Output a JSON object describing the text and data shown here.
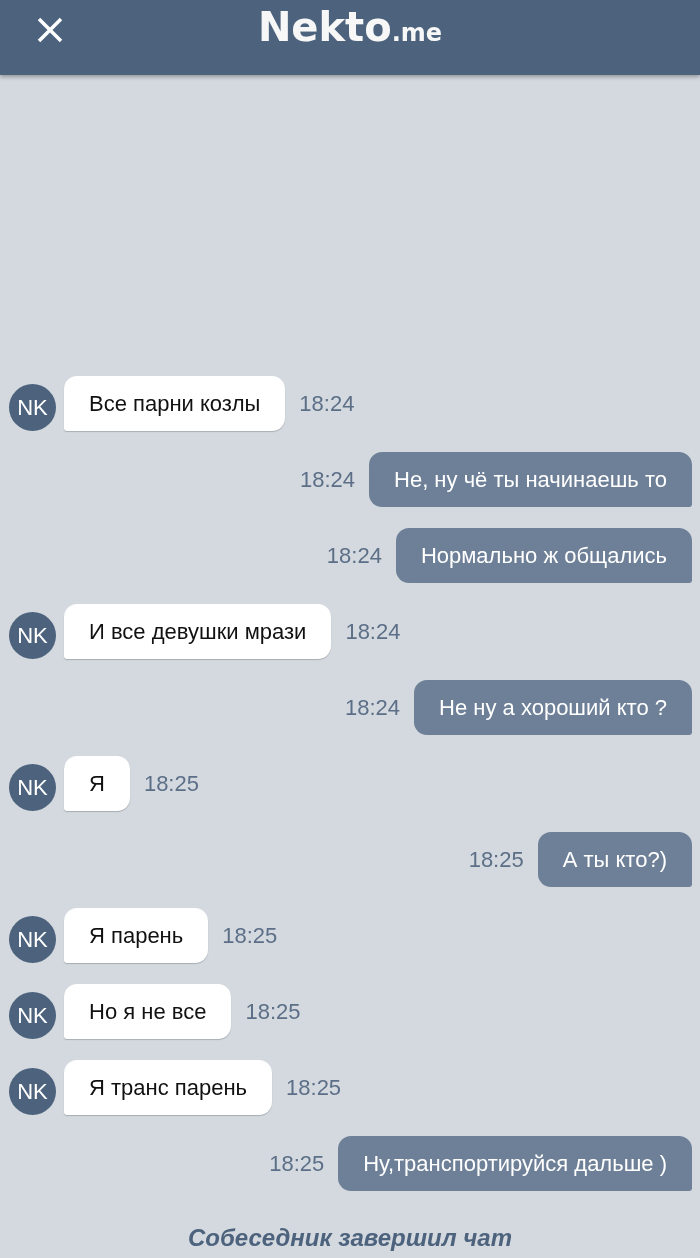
{
  "header": {
    "logo": "Nekto",
    "logo_suffix": ".me"
  },
  "messages": [
    {
      "kind": "incoming",
      "avatar": "NK",
      "text": "Все парни козлы",
      "time": "18:24"
    },
    {
      "kind": "outgoing",
      "text": "Не, ну чё ты начинаешь то",
      "time": "18:24"
    },
    {
      "kind": "outgoing",
      "text": "Нормально ж общались",
      "time": "18:24"
    },
    {
      "kind": "incoming",
      "avatar": "NK",
      "text": "И все девушки мрази",
      "time": "18:24"
    },
    {
      "kind": "outgoing",
      "text": "Не ну а хороший кто ?",
      "time": "18:24"
    },
    {
      "kind": "incoming",
      "avatar": "NK",
      "text": "Я",
      "time": "18:25"
    },
    {
      "kind": "outgoing",
      "text": "А ты кто?)",
      "time": "18:25"
    },
    {
      "kind": "incoming",
      "avatar": "NK",
      "text": "Я парень",
      "time": "18:25"
    },
    {
      "kind": "incoming",
      "avatar": "NK",
      "text": "Но я не все",
      "time": "18:25"
    },
    {
      "kind": "incoming",
      "avatar": "NK",
      "text": "Я транс парень",
      "time": "18:25"
    },
    {
      "kind": "outgoing",
      "text": "Ну,транспортируйся дальше )",
      "time": "18:25"
    }
  ],
  "notice": "Собеседник завершил чат"
}
